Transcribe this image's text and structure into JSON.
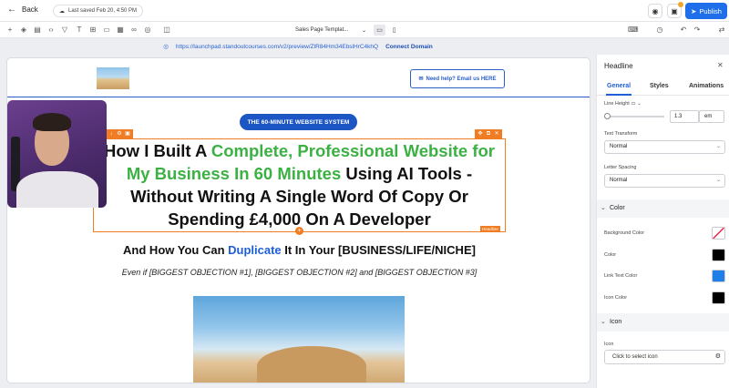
{
  "topbar": {
    "back_label": "Back",
    "saved_text": "Last saved Feb 20, 4:50 PM",
    "publish_label": "Publish"
  },
  "toolbar": {
    "template_name": "Sales Page Templat..."
  },
  "urlbar": {
    "url": "https://launchpad.standoutcourses.com/v2/preview/ZlR84Hm34EbslHrC4khQ",
    "connect_label": "Connect Domain"
  },
  "canvas": {
    "help_button": "Need help? Email us HERE",
    "pill": "THE 60-MINUTE WEBSITE SYSTEM",
    "headline": {
      "part1": "How I Built A ",
      "highlight": "Complete, Professional Website for My Business In 60 Minutes",
      "part2": " Using AI Tools - Without Writing A Single Word Of Copy Or Spending £4,000 On A Developer"
    },
    "element_label": "Headline",
    "subhead": {
      "part1": "And How You Can ",
      "highlight": "Duplicate",
      "part2": " It In Your [BUSINESS/LIFE/NICHE]"
    },
    "objections": "Even if [BIGGEST OBJECTION #1], [BIGGEST OBJECTION #2] and [BIGGEST OBJECTION #3]"
  },
  "panel": {
    "title": "Headline",
    "tabs": [
      "General",
      "Styles",
      "Animations"
    ],
    "line_height_label": "Line Height",
    "line_height_value": "1.3",
    "line_height_unit": "em",
    "text_transform_label": "Text Transform",
    "text_transform_value": "Normal",
    "letter_spacing_label": "Letter Spacing",
    "letter_spacing_value": "Normal",
    "color_section": "Color",
    "background_color_label": "Background Color",
    "color_label": "Color",
    "link_text_color_label": "Link Text Color",
    "icon_color_label": "Icon Color",
    "icon_section": "Icon",
    "icon_label": "Icon",
    "icon_placeholder": "Click to select icon"
  },
  "colors": {
    "accent": "#1f6fea",
    "headline_green": "#3bb143",
    "selection": "#f07d24",
    "swatch_color": "#000000",
    "swatch_link": "#1f7ee8",
    "swatch_icon": "#000000"
  }
}
